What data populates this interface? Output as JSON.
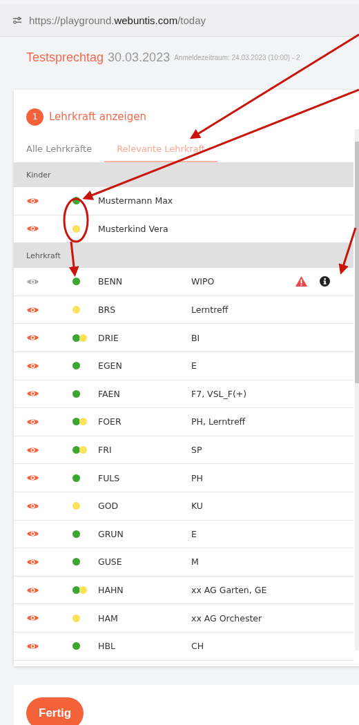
{
  "address_bar": {
    "url_host_prefix": "https://playground.",
    "url_domain": "webuntis.com",
    "url_path": "/today"
  },
  "header": {
    "title": "Testsprechtag",
    "date": "30.03.2023",
    "period": "Anmeldezeitraum: 24.03.2023 (10:00) - 2"
  },
  "step": {
    "number": "1",
    "label": "Lehrkraft anzeigen"
  },
  "tabs": [
    {
      "label": "Alle Lehrkräfte",
      "selected": false
    },
    {
      "label": "Relevante Lehrkraft",
      "selected": true
    }
  ],
  "sections": [
    {
      "title": "Kinder",
      "rows": [
        {
          "eye_active": true,
          "dots": [
            {
              "color": "#3da531"
            }
          ],
          "name": "Mustermann Max",
          "warning": false,
          "info": false
        },
        {
          "eye_active": true,
          "dots": [
            {
              "color": "#fce25c"
            }
          ],
          "name": "Musterkind Vera",
          "warning": false,
          "info": false
        }
      ]
    },
    {
      "title": "Lehrkraft",
      "rows": [
        {
          "eye_active": false,
          "dots": [
            {
              "color": "#3da531"
            }
          ],
          "name": "BENN",
          "subject": "WIPO",
          "warning": true,
          "info": true
        },
        {
          "eye_active": true,
          "dots": [
            {
              "color": "#fce25c"
            }
          ],
          "name": "BRS",
          "subject": "Lerntreff",
          "warning": false,
          "info": false
        },
        {
          "eye_active": true,
          "dots": [
            {
              "color": "#3da531"
            },
            {
              "color": "#fce25c"
            }
          ],
          "name": "DRIE",
          "subject": "BI",
          "warning": false,
          "info": false
        },
        {
          "eye_active": true,
          "dots": [
            {
              "color": "#3da531"
            }
          ],
          "name": "EGEN",
          "subject": "E",
          "warning": false,
          "info": false
        },
        {
          "eye_active": true,
          "dots": [
            {
              "color": "#3da531"
            }
          ],
          "name": "FAEN",
          "subject": "F7, VSL_F(+)",
          "warning": false,
          "info": false
        },
        {
          "eye_active": true,
          "dots": [
            {
              "color": "#3da531"
            },
            {
              "color": "#fce25c"
            }
          ],
          "name": "FOER",
          "subject": "PH, Lerntreff",
          "warning": false,
          "info": false
        },
        {
          "eye_active": true,
          "dots": [
            {
              "color": "#3da531"
            },
            {
              "color": "#fce25c"
            }
          ],
          "name": "FRI",
          "subject": "SP",
          "warning": false,
          "info": false
        },
        {
          "eye_active": true,
          "dots": [
            {
              "color": "#3da531"
            }
          ],
          "name": "FULS",
          "subject": "PH",
          "warning": false,
          "info": false
        },
        {
          "eye_active": true,
          "dots": [
            {
              "color": "#fce25c"
            }
          ],
          "name": "GOD",
          "subject": "KU",
          "warning": false,
          "info": false
        },
        {
          "eye_active": true,
          "dots": [
            {
              "color": "#3da531"
            }
          ],
          "name": "GRUN",
          "subject": "E",
          "warning": false,
          "info": false
        },
        {
          "eye_active": true,
          "dots": [
            {
              "color": "#3da531"
            }
          ],
          "name": "GUSE",
          "subject": "M",
          "warning": false,
          "info": false
        },
        {
          "eye_active": true,
          "dots": [
            {
              "color": "#3da531"
            },
            {
              "color": "#fce25c"
            }
          ],
          "name": "HAHN",
          "subject": "xx AG Garten, GE",
          "warning": false,
          "info": false
        },
        {
          "eye_active": true,
          "dots": [
            {
              "color": "#fce25c"
            }
          ],
          "name": "HAM",
          "subject": "xx AG Orchester",
          "warning": false,
          "info": false
        },
        {
          "eye_active": true,
          "dots": [
            {
              "color": "#3da531"
            }
          ],
          "name": "HBL",
          "subject": "CH",
          "warning": false,
          "info": false
        }
      ]
    }
  ],
  "done_button": "Fertig"
}
